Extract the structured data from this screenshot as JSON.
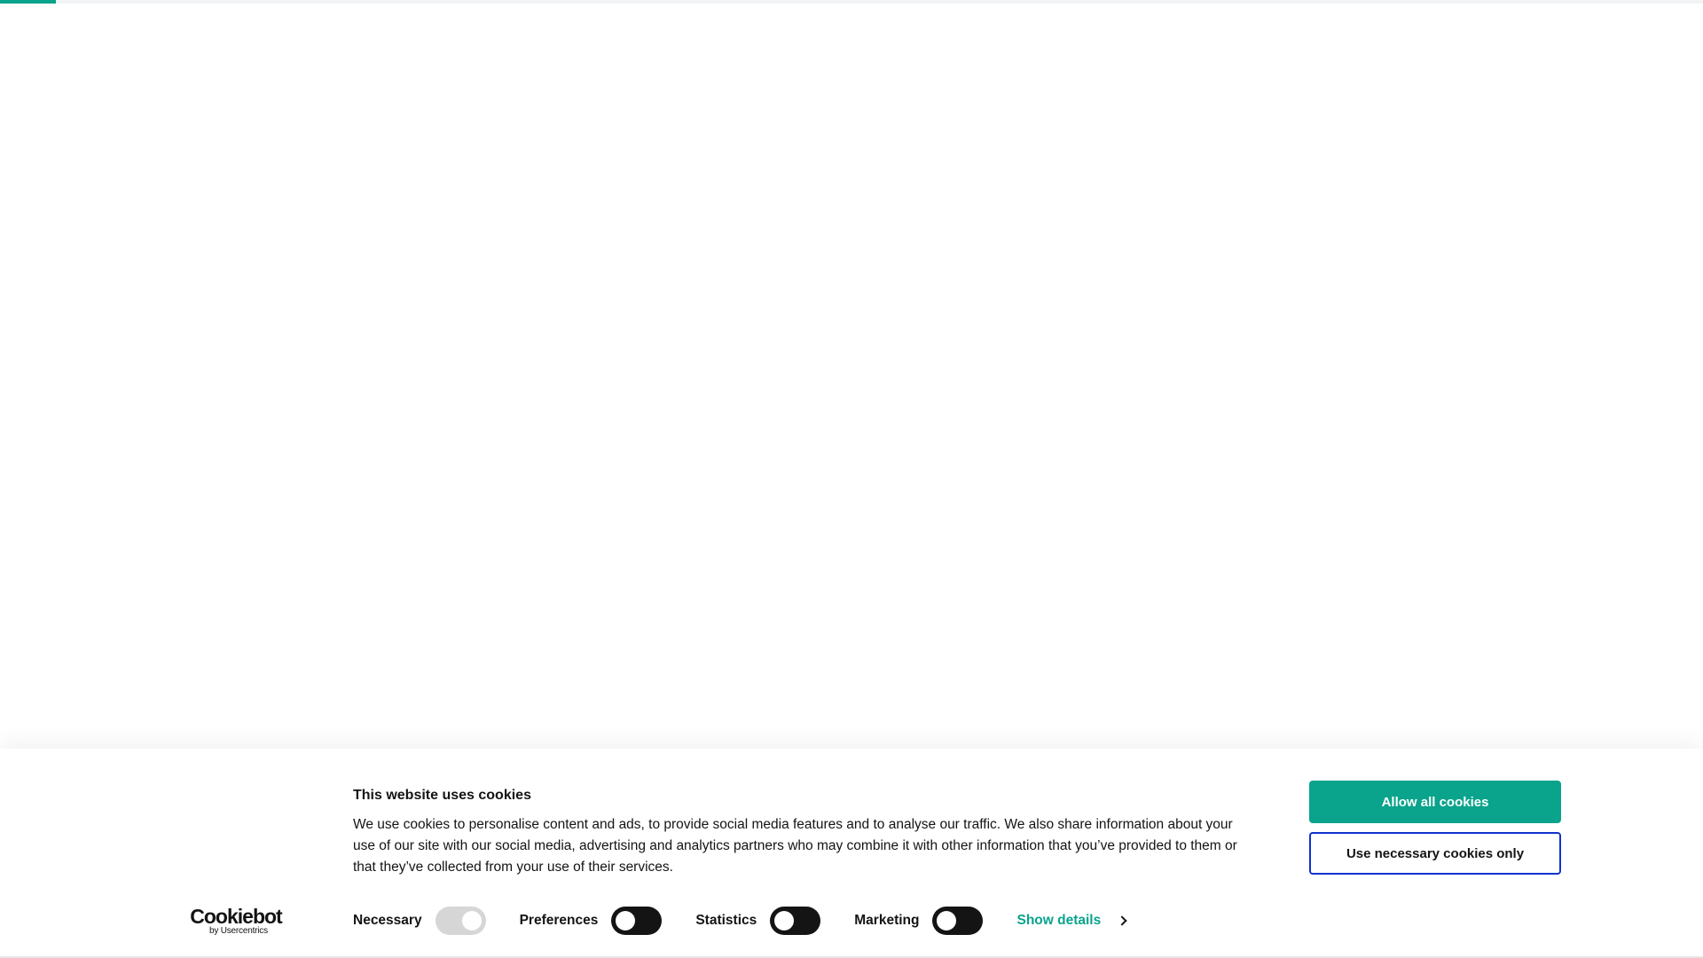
{
  "page_progress": 0.033,
  "cookie_banner": {
    "title": "This website uses cookies",
    "description": "We use cookies to personalise content and ads, to provide social media features and to analyse our traffic. We also share information about your use of our site with our social media, advertising and analytics partners who may combine it with other information that you’ve provided to them or that they’ve collected from your use of their services.",
    "allow_all_label": "Allow all cookies",
    "necessary_only_label": "Use necessary cookies only",
    "logo": {
      "main": "Cookiebot",
      "sub": "by Usercentrics"
    },
    "toggles": [
      {
        "label": "Necessary",
        "checked": true,
        "disabled": true
      },
      {
        "label": "Preferences",
        "checked": false,
        "disabled": false
      },
      {
        "label": "Statistics",
        "checked": false,
        "disabled": false
      },
      {
        "label": "Marketing",
        "checked": false,
        "disabled": false
      }
    ],
    "show_details_label": "Show details",
    "colors": {
      "accent": "#0aa38c",
      "focus_border": "#1032cf",
      "toggle_off": "#141414",
      "toggle_disabled": "#d6d6d6",
      "text": "#141414"
    }
  }
}
